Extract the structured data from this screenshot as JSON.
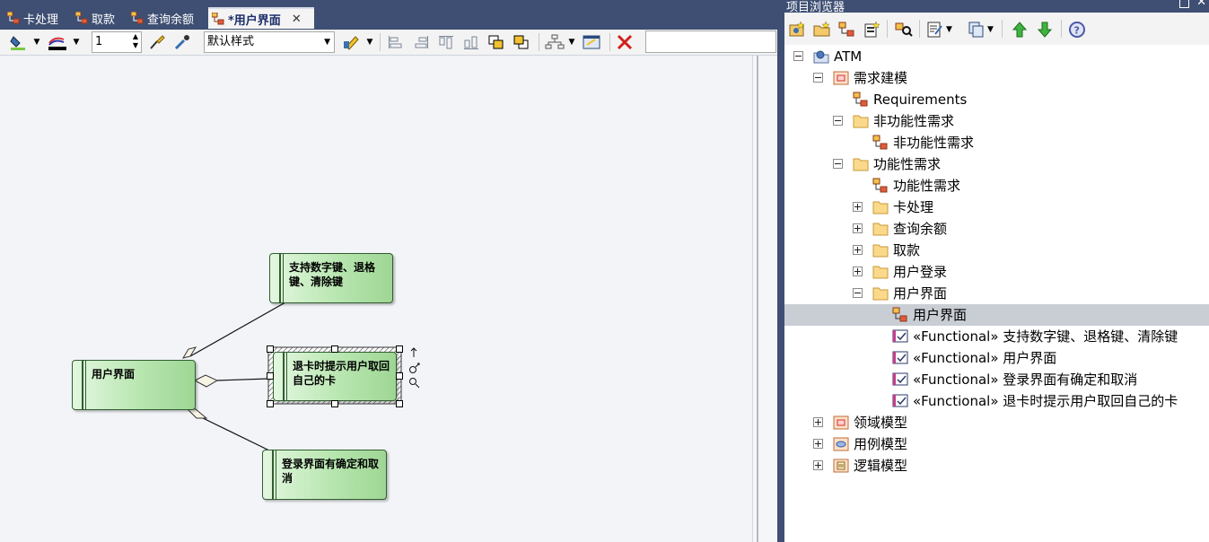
{
  "tabs": [
    {
      "label": "卡处理"
    },
    {
      "label": "取款"
    },
    {
      "label": "查询余额"
    },
    {
      "label": "*用户界面",
      "active": true
    }
  ],
  "toolbar": {
    "line_width": "1",
    "style_value": "默认样式"
  },
  "diagram": {
    "elements": {
      "ui": "用户界面",
      "keys": "支持数字键、退格键、清除键",
      "eject": "退卡时提示用户取回自己的卡",
      "login": "登录界面有确定和取消"
    }
  },
  "browser": {
    "title": "项目浏览器",
    "tree": [
      {
        "label": "ATM",
        "icon": "model-root-icon",
        "expander": "minus"
      },
      {
        "label": "需求建模",
        "icon": "package-icon",
        "expander": "minus"
      },
      {
        "label": "Requirements",
        "icon": "diagram-icon",
        "expander": "none"
      },
      {
        "label": "非功能性需求",
        "icon": "folder-icon",
        "expander": "minus"
      },
      {
        "label": "非功能性需求",
        "icon": "diagram-icon",
        "expander": "none"
      },
      {
        "label": "功能性需求",
        "icon": "folder-icon",
        "expander": "minus"
      },
      {
        "label": "功能性需求",
        "icon": "diagram-icon",
        "expander": "none"
      },
      {
        "label": "卡处理",
        "icon": "folder-icon",
        "expander": "plus"
      },
      {
        "label": "查询余额",
        "icon": "folder-icon",
        "expander": "plus"
      },
      {
        "label": "取款",
        "icon": "folder-icon",
        "expander": "plus"
      },
      {
        "label": "用户登录",
        "icon": "folder-icon",
        "expander": "plus"
      },
      {
        "label": "用户界面",
        "icon": "folder-icon",
        "expander": "minus"
      },
      {
        "label": "用户界面",
        "icon": "diagram-icon",
        "expander": "none",
        "selected": true
      },
      {
        "label": "«Functional» 支持数字键、退格键、清除键",
        "icon": "requirement-icon",
        "expander": "none"
      },
      {
        "label": "«Functional» 用户界面",
        "icon": "requirement-icon",
        "expander": "none"
      },
      {
        "label": "«Functional» 登录界面有确定和取消",
        "icon": "requirement-icon",
        "expander": "none"
      },
      {
        "label": "«Functional» 退卡时提示用户取回自己的卡",
        "icon": "requirement-icon",
        "expander": "none"
      },
      {
        "label": "领域模型",
        "icon": "package-icon",
        "expander": "plus"
      },
      {
        "label": "用例模型",
        "icon": "usecase-package-icon",
        "expander": "plus"
      },
      {
        "label": "逻辑模型",
        "icon": "logical-package-icon",
        "expander": "plus"
      }
    ]
  },
  "colors": {
    "chrome": "#3e4f73",
    "selection": "#c9cdd4",
    "requirement_fill": "#b8e6b0"
  }
}
